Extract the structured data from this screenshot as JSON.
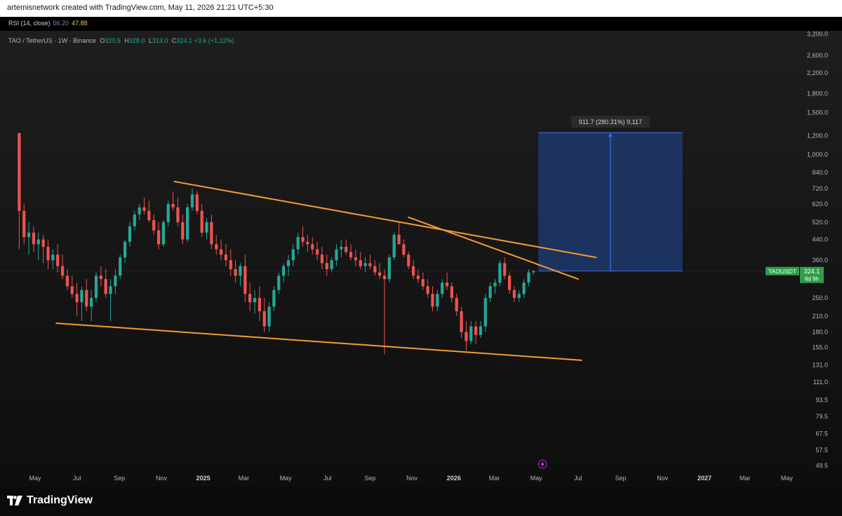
{
  "header": {
    "credit": "artemisnetwork created with TradingView.com, May 11, 2026 21:21 UTC+5:30"
  },
  "rsi": {
    "label": "RSI (14, close)",
    "value1": "56.20",
    "value2": "47.88",
    "color1": "#8e7cc3",
    "color2": "#e6c84c"
  },
  "legend": {
    "symbol": "TAO / TetherUS · 1W · Binance",
    "o_label": "O",
    "o_value": "320.5",
    "h_label": "H",
    "h_value": "328.0",
    "l_label": "L",
    "l_value": "313.0",
    "c_label": "C",
    "c_value": "324.1",
    "change": "+3.6 (+1.12%)"
  },
  "price_tag": {
    "symbol": "TAOUSDT",
    "price": "324.1",
    "countdown": "6d 9h",
    "color": "#2e9e48"
  },
  "measure": {
    "label": "911.7 (280.31%) 9,117"
  },
  "brand": {
    "name": "TradingView"
  },
  "colors": {
    "up": "#26a69a",
    "down": "#ef5350",
    "trendline": "#f39c32",
    "measure_fill": "#1f3d7a",
    "measure_line": "#3a6ee8"
  },
  "icons": [
    "flash-icon",
    "tradingview-logo-icon"
  ],
  "chart_data": {
    "type": "candlestick",
    "title": "TAO / TetherUS · 1W · Binance",
    "y_scale": "log",
    "ylim": [
      46,
      3300
    ],
    "y_ticks": [
      "3,200.0",
      "2,600.0",
      "2,200.0",
      "1,800.0",
      "1,500.0",
      "1,200.0",
      "1,000.0",
      "840.0",
      "720.0",
      "620.0",
      "520.0",
      "440.0",
      "360.0",
      "250.0",
      "210.0",
      "180.0",
      "155.0",
      "131.0",
      "111.0",
      "93.5",
      "79.5",
      "67.5",
      "57.5",
      "49.5"
    ],
    "x_ticks": [
      {
        "label": "May",
        "date": "2024-05-01"
      },
      {
        "label": "Jul",
        "date": "2024-07-01"
      },
      {
        "label": "Sep",
        "date": "2024-09-01"
      },
      {
        "label": "Nov",
        "date": "2024-11-01"
      },
      {
        "label": "2025",
        "date": "2025-01-01",
        "bold": true
      },
      {
        "label": "Mar",
        "date": "2025-03-01"
      },
      {
        "label": "May",
        "date": "2025-05-01"
      },
      {
        "label": "Jul",
        "date": "2025-07-01"
      },
      {
        "label": "Sep",
        "date": "2025-09-01"
      },
      {
        "label": "Nov",
        "date": "2025-11-01"
      },
      {
        "label": "2026",
        "date": "2026-01-01",
        "bold": true
      },
      {
        "label": "Mar",
        "date": "2026-03-01"
      },
      {
        "label": "May",
        "date": "2026-05-01"
      },
      {
        "label": "Jul",
        "date": "2026-07-01"
      },
      {
        "label": "Sep",
        "date": "2026-09-01"
      },
      {
        "label": "Nov",
        "date": "2026-11-01"
      },
      {
        "label": "2027",
        "date": "2027-01-01",
        "bold": true
      },
      {
        "label": "Mar",
        "date": "2027-03-01"
      },
      {
        "label": "May",
        "date": "2027-05-01"
      }
    ],
    "x_range": [
      "2024-03-11",
      "2027-05-20"
    ],
    "first_candle": "2024-04-08",
    "candles": [
      [
        1230,
        1230,
        400,
        580
      ],
      [
        580,
        620,
        420,
        450
      ],
      [
        450,
        520,
        380,
        470
      ],
      [
        470,
        500,
        390,
        420
      ],
      [
        420,
        470,
        360,
        440
      ],
      [
        440,
        460,
        350,
        410
      ],
      [
        410,
        440,
        330,
        360
      ],
      [
        360,
        400,
        330,
        380
      ],
      [
        380,
        420,
        320,
        340
      ],
      [
        340,
        380,
        300,
        310
      ],
      [
        310,
        330,
        270,
        280
      ],
      [
        280,
        310,
        250,
        260
      ],
      [
        260,
        290,
        210,
        240
      ],
      [
        240,
        280,
        200,
        270
      ],
      [
        270,
        300,
        220,
        230
      ],
      [
        230,
        270,
        200,
        250
      ],
      [
        250,
        320,
        240,
        310
      ],
      [
        310,
        340,
        280,
        300
      ],
      [
        300,
        330,
        250,
        260
      ],
      [
        260,
        300,
        200,
        280
      ],
      [
        280,
        330,
        260,
        310
      ],
      [
        310,
        380,
        300,
        370
      ],
      [
        370,
        440,
        350,
        430
      ],
      [
        430,
        520,
        410,
        500
      ],
      [
        500,
        580,
        480,
        560
      ],
      [
        560,
        620,
        530,
        600
      ],
      [
        600,
        660,
        560,
        580
      ],
      [
        580,
        640,
        520,
        530
      ],
      [
        530,
        560,
        460,
        480
      ],
      [
        480,
        520,
        400,
        420
      ],
      [
        420,
        530,
        410,
        520
      ],
      [
        520,
        640,
        500,
        620
      ],
      [
        620,
        700,
        580,
        600
      ],
      [
        600,
        660,
        500,
        520
      ],
      [
        520,
        560,
        420,
        440
      ],
      [
        440,
        620,
        430,
        600
      ],
      [
        600,
        720,
        580,
        680
      ],
      [
        680,
        700,
        560,
        580
      ],
      [
        580,
        620,
        450,
        470
      ],
      [
        470,
        540,
        440,
        520
      ],
      [
        520,
        560,
        400,
        420
      ],
      [
        420,
        460,
        380,
        400
      ],
      [
        400,
        440,
        360,
        380
      ],
      [
        380,
        420,
        340,
        360
      ],
      [
        360,
        400,
        310,
        330
      ],
      [
        330,
        360,
        290,
        310
      ],
      [
        310,
        350,
        280,
        340
      ],
      [
        340,
        380,
        240,
        260
      ],
      [
        260,
        290,
        220,
        240
      ],
      [
        240,
        270,
        215,
        250
      ],
      [
        250,
        280,
        200,
        220
      ],
      [
        220,
        250,
        180,
        190
      ],
      [
        190,
        240,
        180,
        230
      ],
      [
        230,
        280,
        220,
        270
      ],
      [
        270,
        320,
        260,
        310
      ],
      [
        310,
        350,
        290,
        340
      ],
      [
        340,
        380,
        310,
        360
      ],
      [
        360,
        420,
        340,
        400
      ],
      [
        400,
        470,
        380,
        450
      ],
      [
        450,
        500,
        410,
        430
      ],
      [
        430,
        460,
        390,
        420
      ],
      [
        420,
        450,
        380,
        400
      ],
      [
        400,
        430,
        360,
        380
      ],
      [
        380,
        410,
        330,
        350
      ],
      [
        350,
        380,
        310,
        330
      ],
      [
        330,
        370,
        320,
        360
      ],
      [
        360,
        420,
        340,
        400
      ],
      [
        400,
        440,
        370,
        410
      ],
      [
        410,
        440,
        380,
        390
      ],
      [
        390,
        420,
        360,
        370
      ],
      [
        370,
        400,
        340,
        360
      ],
      [
        360,
        390,
        330,
        340
      ],
      [
        340,
        370,
        320,
        350
      ],
      [
        350,
        380,
        330,
        340
      ],
      [
        340,
        360,
        310,
        320
      ],
      [
        320,
        350,
        300,
        310
      ],
      [
        310,
        330,
        145,
        300
      ],
      [
        300,
        380,
        290,
        370
      ],
      [
        370,
        470,
        360,
        460
      ],
      [
        460,
        520,
        440,
        420
      ],
      [
        420,
        440,
        370,
        380
      ],
      [
        380,
        390,
        330,
        340
      ],
      [
        340,
        360,
        300,
        310
      ],
      [
        310,
        330,
        290,
        300
      ],
      [
        300,
        320,
        270,
        280
      ],
      [
        280,
        300,
        250,
        260
      ],
      [
        260,
        280,
        220,
        230
      ],
      [
        230,
        270,
        220,
        260
      ],
      [
        260,
        300,
        250,
        290
      ],
      [
        290,
        320,
        270,
        280
      ],
      [
        280,
        290,
        240,
        250
      ],
      [
        250,
        260,
        210,
        220
      ],
      [
        220,
        230,
        170,
        180
      ],
      [
        180,
        200,
        150,
        165
      ],
      [
        165,
        200,
        160,
        190
      ],
      [
        190,
        200,
        160,
        175
      ],
      [
        175,
        200,
        170,
        190
      ],
      [
        190,
        260,
        180,
        250
      ],
      [
        250,
        290,
        240,
        280
      ],
      [
        280,
        300,
        260,
        290
      ],
      [
        290,
        360,
        280,
        350
      ],
      [
        350,
        370,
        300,
        310
      ],
      [
        310,
        320,
        260,
        270
      ],
      [
        270,
        280,
        240,
        250
      ],
      [
        250,
        270,
        240,
        260
      ],
      [
        260,
        300,
        250,
        290
      ],
      [
        290,
        330,
        280,
        320
      ],
      [
        320.5,
        328,
        313,
        324.1
      ]
    ],
    "annotations": {
      "upper_trendline": {
        "from": {
          "date": "2024-11-20",
          "price": 770
        },
        "to": {
          "date": "2026-07-27",
          "price": 370
        }
      },
      "lower_trendline": {
        "from": {
          "date": "2024-06-01",
          "price": 196
        },
        "to": {
          "date": "2026-07-06",
          "price": 137
        }
      },
      "steep_trendline": {
        "from": {
          "date": "2025-10-27",
          "price": 545
        },
        "to": {
          "date": "2026-07-01",
          "price": 300
        }
      },
      "long_position": {
        "from_date": "2026-05-04",
        "to_date": "2026-11-30",
        "entry": 324.1,
        "target": 1235,
        "label": "911.7 (280.31%) 9,117"
      },
      "current_price": 324.1
    }
  }
}
